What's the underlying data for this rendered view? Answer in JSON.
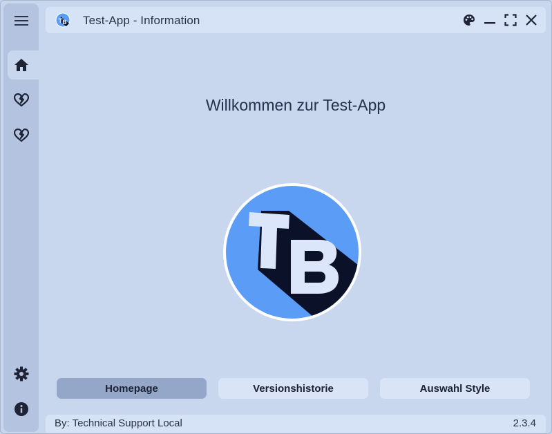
{
  "window": {
    "title": "Test-App - Information"
  },
  "sidebar": {
    "items": [
      {
        "icon": "menu-icon"
      },
      {
        "icon": "home-icon",
        "active": true
      },
      {
        "icon": "broken-heart-icon"
      },
      {
        "icon": "broken-heart-icon"
      },
      {
        "icon": "gear-icon"
      },
      {
        "icon": "info-icon"
      }
    ]
  },
  "main": {
    "welcome": "Willkommen zur Test-App",
    "logo_text": "TB"
  },
  "nav": {
    "buttons": [
      {
        "label": "Homepage",
        "active": true
      },
      {
        "label": "Versionshistorie",
        "active": false
      },
      {
        "label": "Auswahl Style",
        "active": false
      }
    ]
  },
  "status": {
    "author": "By: Technical Support Local",
    "version": "2.3.4"
  },
  "colors": {
    "background": "#c8d6ee",
    "sidebar": "#b4c4e0",
    "bar": "#d6e2f6",
    "active_button": "#94a7c8",
    "logo_blue": "#5b9cf6",
    "logo_shadow": "#0a1128",
    "logo_letters": "#dbe6fa"
  }
}
